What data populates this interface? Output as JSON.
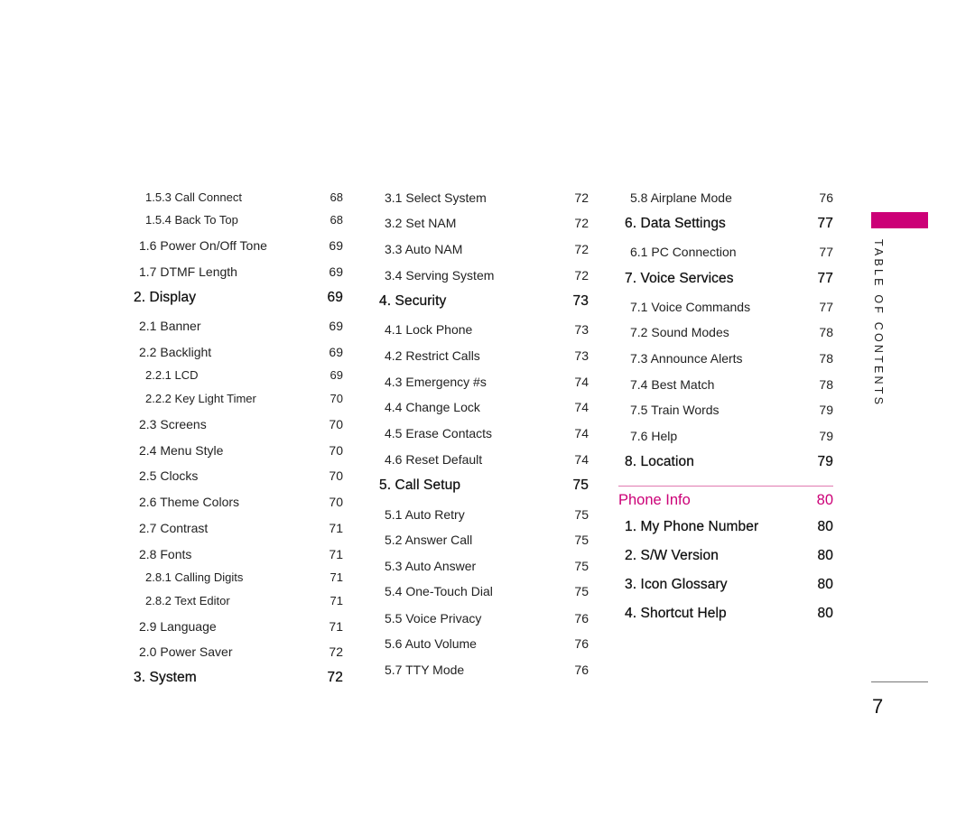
{
  "columns": [
    {
      "entries": [
        {
          "label": "1.5.3 Call Connect",
          "page": "68",
          "level": 3
        },
        {
          "label": "1.5.4 Back To Top",
          "page": "68",
          "level": 3
        },
        {
          "label": "1.6 Power On/Off Tone",
          "page": "69",
          "level": 2
        },
        {
          "label": "1.7 DTMF Length",
          "page": "69",
          "level": 2
        },
        {
          "label": "2. Display",
          "page": "69",
          "level": 1
        },
        {
          "label": "2.1 Banner",
          "page": "69",
          "level": 2
        },
        {
          "label": "2.2 Backlight",
          "page": "69",
          "level": 2
        },
        {
          "label": "2.2.1 LCD",
          "page": "69",
          "level": 3
        },
        {
          "label": "2.2.2 Key Light Timer",
          "page": "70",
          "level": 3
        },
        {
          "label": "2.3 Screens",
          "page": "70",
          "level": 2
        },
        {
          "label": "2.4 Menu Style",
          "page": "70",
          "level": 2
        },
        {
          "label": "2.5 Clocks",
          "page": "70",
          "level": 2
        },
        {
          "label": "2.6 Theme Colors",
          "page": "70",
          "level": 2
        },
        {
          "label": "2.7 Contrast",
          "page": "71",
          "level": 2
        },
        {
          "label": "2.8 Fonts",
          "page": "71",
          "level": 2
        },
        {
          "label": "2.8.1 Calling Digits",
          "page": "71",
          "level": 3
        },
        {
          "label": "2.8.2 Text Editor",
          "page": "71",
          "level": 3
        },
        {
          "label": "2.9 Language",
          "page": "71",
          "level": 2
        },
        {
          "label": "2.0 Power Saver",
          "page": "72",
          "level": 2
        },
        {
          "label": "3. System",
          "page": "72",
          "level": 1
        }
      ]
    },
    {
      "entries": [
        {
          "label": "3.1 Select System",
          "page": "72",
          "level": 2
        },
        {
          "label": "3.2 Set NAM",
          "page": "72",
          "level": 2
        },
        {
          "label": "3.3 Auto NAM",
          "page": "72",
          "level": 2
        },
        {
          "label": "3.4 Serving System",
          "page": "72",
          "level": 2
        },
        {
          "label": "4. Security",
          "page": "73",
          "level": 1
        },
        {
          "label": "4.1 Lock Phone",
          "page": "73",
          "level": 2
        },
        {
          "label": "4.2 Restrict Calls",
          "page": "73",
          "level": 2
        },
        {
          "label": "4.3 Emergency #s",
          "page": "74",
          "level": 2
        },
        {
          "label": "4.4 Change Lock",
          "page": "74",
          "level": 2
        },
        {
          "label": "4.5 Erase Contacts",
          "page": "74",
          "level": 2
        },
        {
          "label": "4.6 Reset Default",
          "page": "74",
          "level": 2
        },
        {
          "label": "5. Call Setup",
          "page": "75",
          "level": 1
        },
        {
          "label": "5.1 Auto Retry",
          "page": "75",
          "level": 2
        },
        {
          "label": "5.2 Answer Call",
          "page": "75",
          "level": 2
        },
        {
          "label": "5.3 Auto Answer",
          "page": "75",
          "level": 2
        },
        {
          "label": "5.4 One-Touch Dial",
          "page": "75",
          "level": 2
        },
        {
          "label": "5.5 Voice Privacy",
          "page": "76",
          "level": 2
        },
        {
          "label": "5.6 Auto Volume",
          "page": "76",
          "level": 2
        },
        {
          "label": "5.7 TTY Mode",
          "page": "76",
          "level": 2
        }
      ]
    },
    {
      "entries": [
        {
          "label": "5.8 Airplane Mode",
          "page": "76",
          "level": 2
        },
        {
          "label": "6. Data Settings",
          "page": "77",
          "level": 1
        },
        {
          "label": "6.1 PC Connection",
          "page": "77",
          "level": 2
        },
        {
          "label": "7. Voice Services",
          "page": "77",
          "level": 1
        },
        {
          "label": "7.1 Voice Commands",
          "page": "77",
          "level": 2
        },
        {
          "label": "7.2 Sound Modes",
          "page": "78",
          "level": 2
        },
        {
          "label": "7.3 Announce Alerts",
          "page": "78",
          "level": 2
        },
        {
          "label": "7.4 Best Match",
          "page": "78",
          "level": 2
        },
        {
          "label": "7.5 Train Words",
          "page": "79",
          "level": 2
        },
        {
          "label": "7.6 Help",
          "page": "79",
          "level": 2
        },
        {
          "label": "8. Location",
          "page": "79",
          "level": 1
        }
      ],
      "section": {
        "title": "Phone Info",
        "page": "80",
        "entries": [
          {
            "label": "1. My Phone Number",
            "page": "80",
            "level": 1
          },
          {
            "label": "2. S/W Version",
            "page": "80",
            "level": 1
          },
          {
            "label": "3. Icon Glossary",
            "page": "80",
            "level": 1
          },
          {
            "label": "4. Shortcut Help",
            "page": "80",
            "level": 1
          }
        ]
      }
    }
  ],
  "side_tab": {
    "label": "TABLE OF CONTENTS",
    "accent_color": "#cc0077"
  },
  "page_number": "7"
}
